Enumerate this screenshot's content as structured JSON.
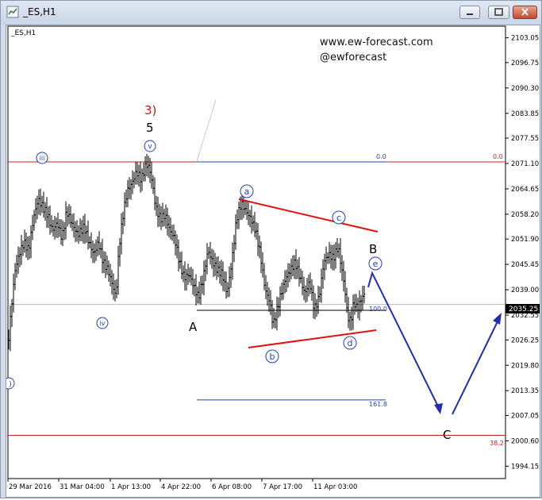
{
  "window": {
    "title": "_ES,H1"
  },
  "chart_label": "_ES,H1",
  "watermark": {
    "line1": "www.ew-forecast.com",
    "line2": "@ewforecast"
  },
  "chart_data": {
    "type": "candlestick",
    "symbol": "_ES",
    "timeframe": "H1",
    "ylim": [
      1991,
      2106
    ],
    "current_price": "2035.25",
    "y_ticks": [
      "2103.05",
      "2096.75",
      "2090.30",
      "2083.85",
      "2077.55",
      "2071.10",
      "2064.65",
      "2058.20",
      "2051.90",
      "2045.45",
      "2039.00",
      "2032.55",
      "2026.25",
      "2019.80",
      "2013.35",
      "2007.05",
      "2000.60",
      "1994.15"
    ],
    "x_ticks": [
      "29 Mar 2016",
      "31 Mar 04:00",
      "1 Apr 13:00",
      "4 Apr 22:00",
      "6 Apr 08:00",
      "7 Apr 17:00",
      "11 Apr 03:00"
    ],
    "fibonacci": [
      {
        "label": "0.0",
        "price": 2071.5
      },
      {
        "label": "100.0",
        "price": 2035.3
      },
      {
        "label": "161.8",
        "price": 2011.0
      }
    ],
    "horizontal_lines": [
      {
        "label": "0.0",
        "price": 2071.5,
        "color": "#d02020"
      },
      {
        "label": "38.2",
        "price": 2002.0,
        "color": "#d02020"
      }
    ],
    "wave_labels": {
      "iii": "iii",
      "iv": "iv",
      "v": "v",
      "five": "5",
      "three": "3)",
      "A": "A",
      "a": "a",
      "b": "b",
      "c": "c",
      "d": "d",
      "e": "e",
      "B": "B",
      "C": "C",
      "i": ")"
    },
    "colors": {
      "candles": "#000000",
      "fib_line": "#1f3fbf",
      "red_line": "#d02020",
      "triangle": "#e01010",
      "projection": "#1f2fb0",
      "wave_label": "#1f3fbf"
    }
  }
}
